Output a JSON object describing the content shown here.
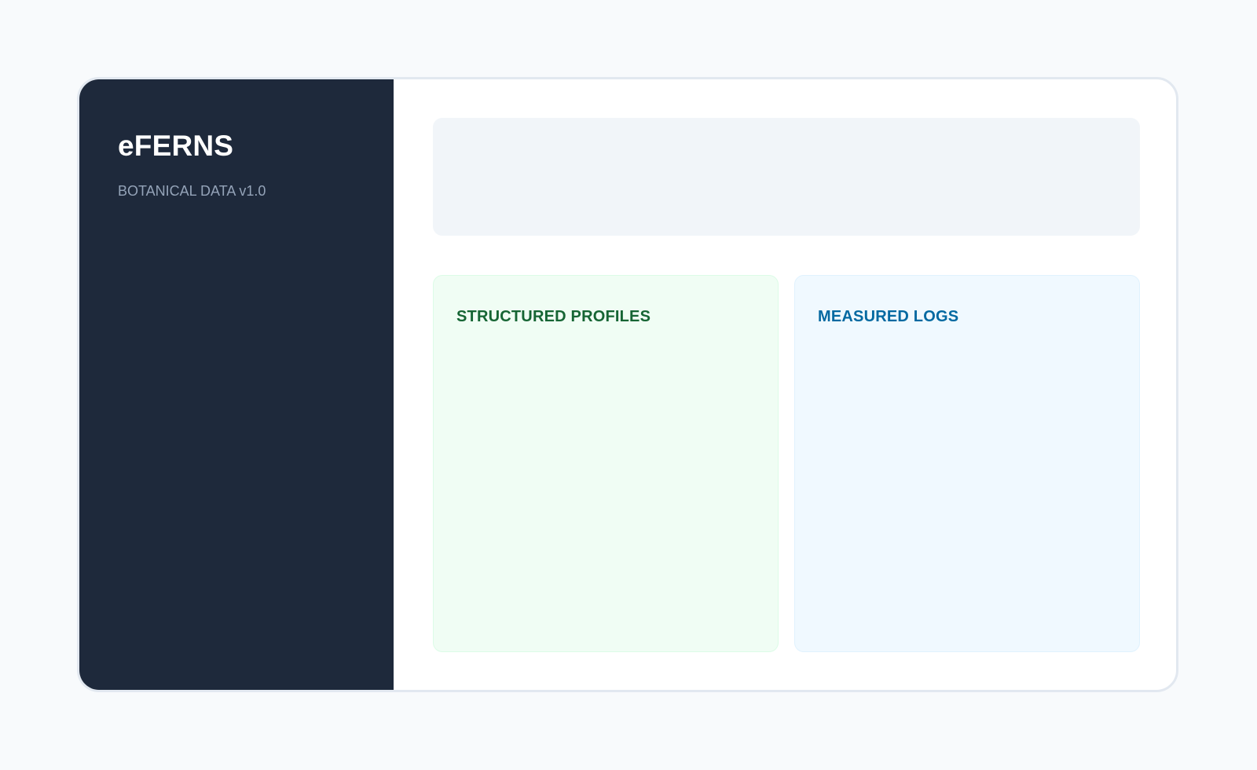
{
  "sidebar": {
    "title": "eFERNS",
    "subtitle": "BOTANICAL DATA v1.0"
  },
  "main": {
    "cards": [
      {
        "title": "STRUCTURED PROFILES",
        "color": "#166534"
      },
      {
        "title": "MEASURED LOGS",
        "color": "#0369a1"
      }
    ]
  },
  "colors": {
    "sidebar_bg": "#1e293b",
    "page_bg": "#f8fafc",
    "header_panel_bg": "#f1f5f9",
    "profiles_card_bg": "#f0fdf4",
    "logs_card_bg": "#f0f9ff"
  }
}
